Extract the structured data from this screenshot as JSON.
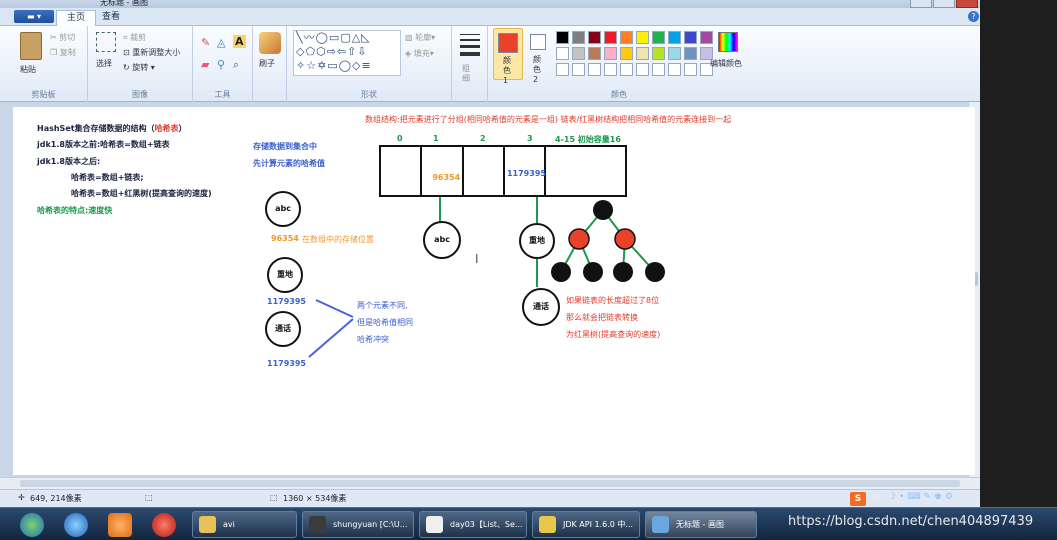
{
  "window": {
    "title": "无标题 - 画图"
  },
  "ribbon": {
    "tabs": [
      "主页",
      "查看"
    ],
    "clipboard": {
      "paste": "粘贴",
      "cut": "剪切",
      "copy": "复制",
      "group": "剪贴板"
    },
    "image": {
      "select": "选择",
      "crop": "裁剪",
      "resize": "重新调整大小",
      "rotate": "旋转",
      "group": "图像"
    },
    "tools": {
      "group": "工具"
    },
    "brushes": {
      "label": "刷子"
    },
    "shapes": {
      "outline": "轮廓",
      "fill": "填充",
      "group": "形状"
    },
    "size": {
      "label": "粗细"
    },
    "colors": {
      "color1": "颜色 1",
      "color2": "颜色 2",
      "edit": "编辑颜色",
      "group": "颜色",
      "color1_value": "#e8412c",
      "color2_value": "#ffffff",
      "palette": [
        "#000000",
        "#7f7f7f",
        "#880015",
        "#ed1c24",
        "#ff7f27",
        "#fff200",
        "#22b14c",
        "#00a2e8",
        "#3f48cc",
        "#a349a4",
        "#ffffff",
        "#c3c3c3",
        "#b97a57",
        "#ffaec9",
        "#ffc90e",
        "#efe4b0",
        "#b5e61d",
        "#99d9ea",
        "#7092be",
        "#c8bfe7"
      ]
    }
  },
  "canvas": {
    "notes": {
      "title": "HashSet集合存储数据的结构（",
      "title_hl": "哈希表",
      "title_end": "）",
      "before18": "jdk1.8版本之前:哈希表=数组+链表",
      "after18": "jdk1.8版本之后:",
      "after_a": "哈希表=数组+链表;",
      "after_b": "哈希表=数组+红黑树(提高查询的速度)",
      "feature": "哈希表的特点:速度快"
    },
    "store_note": [
      "存储数据到集合中",
      "先计算元素的哈希值"
    ],
    "elements": {
      "abc": "abc",
      "abc_hash": "96354",
      "abc_pos": "在数组中的存储位置",
      "chongdi": "重地",
      "chongdi_hash": "1179395",
      "tonghua": "通话",
      "tonghua_hash": "1179395"
    },
    "conflict": [
      "两个元素不同,",
      "但是哈希值相同",
      "哈希冲突"
    ],
    "array_title": "数组结构:把元素进行了分组(相同哈希值的元素是一组) 链表/红黑树结构把相同哈希值的元素连接到一起",
    "indices": [
      "0",
      "1",
      "2",
      "3",
      "4-15  初始容量16"
    ],
    "cells": [
      "",
      "96354",
      "",
      "1179395",
      ""
    ],
    "chain_abc": "abc",
    "chain_chongdi": "重地",
    "chain_tonghua": "通话",
    "rbtree_note": [
      "如果链表的长度超过了8位",
      "那么就会把链表转换",
      "为红黑树(提高查询的速度)"
    ]
  },
  "status": {
    "cursor": "649, 214像素",
    "size": "1360 × 534像素"
  },
  "taskbar": {
    "items": [
      {
        "label": "avi",
        "color": "#e7c15a"
      },
      {
        "label": "shungyuan [C:\\U...",
        "color": "#3b3b3b"
      },
      {
        "label": "day03【List、Se...",
        "color": "#f0f0f0"
      },
      {
        "label": "JDK API 1.6.0 中...",
        "color": "#e8c84a"
      },
      {
        "label": "无标题 - 画图",
        "color": "#6aa7de"
      }
    ],
    "tray_text": "中"
  },
  "watermark": "https://blog.csdn.net/chen404897439"
}
